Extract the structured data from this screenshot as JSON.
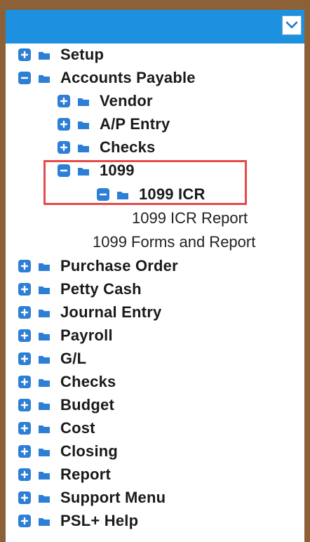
{
  "header": {
    "dropdown_icon": "chevron-down-icon"
  },
  "colors": {
    "accent": "#1e90e0",
    "tree_icon": "#2d7fd6",
    "highlight": "#e64a4a",
    "background": "#8d6138"
  },
  "tree": {
    "setup": {
      "label": "Setup",
      "state": "collapsed",
      "toggle_icon": "plus-icon",
      "node_icon": "folder-icon"
    },
    "accounts_payable": {
      "label": "Accounts Payable",
      "state": "expanded",
      "toggle_icon": "minus-icon",
      "node_icon": "folder-icon"
    },
    "vendor": {
      "label": "Vendor",
      "state": "collapsed",
      "toggle_icon": "plus-icon",
      "node_icon": "folder-icon"
    },
    "ap_entry": {
      "label": "A/P Entry",
      "state": "collapsed",
      "toggle_icon": "plus-icon",
      "node_icon": "folder-icon"
    },
    "checks_ap": {
      "label": "Checks",
      "state": "collapsed",
      "toggle_icon": "plus-icon",
      "node_icon": "folder-icon"
    },
    "node_1099": {
      "label": "1099",
      "state": "expanded",
      "toggle_icon": "minus-icon",
      "node_icon": "folder-icon"
    },
    "icr_1099": {
      "label": "1099 ICR",
      "state": "expanded",
      "toggle_icon": "minus-icon",
      "node_icon": "folder-icon"
    },
    "icr_report": {
      "label": "1099 ICR Report"
    },
    "forms_report": {
      "label": "1099 Forms and Report"
    },
    "purchase_order": {
      "label": "Purchase Order",
      "state": "collapsed",
      "toggle_icon": "plus-icon",
      "node_icon": "folder-icon"
    },
    "petty_cash": {
      "label": "Petty Cash",
      "state": "collapsed",
      "toggle_icon": "plus-icon",
      "node_icon": "folder-icon"
    },
    "journal_entry": {
      "label": "Journal Entry",
      "state": "collapsed",
      "toggle_icon": "plus-icon",
      "node_icon": "folder-icon"
    },
    "payroll": {
      "label": "Payroll",
      "state": "collapsed",
      "toggle_icon": "plus-icon",
      "node_icon": "folder-icon"
    },
    "gl": {
      "label": "G/L",
      "state": "collapsed",
      "toggle_icon": "plus-icon",
      "node_icon": "folder-icon"
    },
    "checks": {
      "label": "Checks",
      "state": "collapsed",
      "toggle_icon": "plus-icon",
      "node_icon": "folder-icon"
    },
    "budget": {
      "label": "Budget",
      "state": "collapsed",
      "toggle_icon": "plus-icon",
      "node_icon": "folder-icon"
    },
    "cost": {
      "label": "Cost",
      "state": "collapsed",
      "toggle_icon": "plus-icon",
      "node_icon": "folder-icon"
    },
    "closing": {
      "label": "Closing",
      "state": "collapsed",
      "toggle_icon": "plus-icon",
      "node_icon": "folder-icon"
    },
    "report": {
      "label": "Report",
      "state": "collapsed",
      "toggle_icon": "plus-icon",
      "node_icon": "folder-icon"
    },
    "support_menu": {
      "label": "Support Menu",
      "state": "collapsed",
      "toggle_icon": "plus-icon",
      "node_icon": "folder-icon"
    },
    "psl_help": {
      "label": "PSL+ Help",
      "state": "collapsed",
      "toggle_icon": "plus-icon",
      "node_icon": "folder-icon"
    }
  }
}
